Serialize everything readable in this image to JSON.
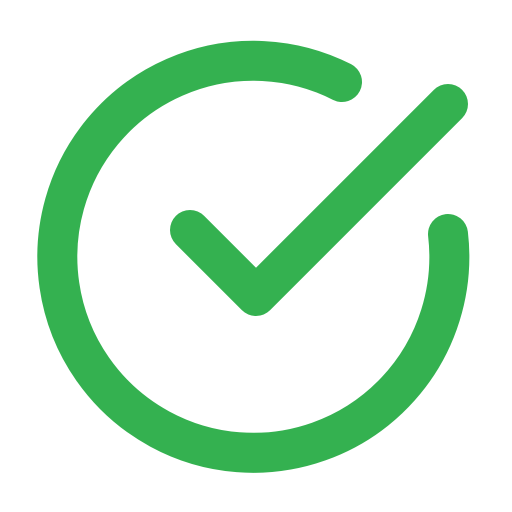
{
  "icon": {
    "name": "check-circle-icon",
    "color": "#34B150",
    "background": "#FFFFFF"
  }
}
